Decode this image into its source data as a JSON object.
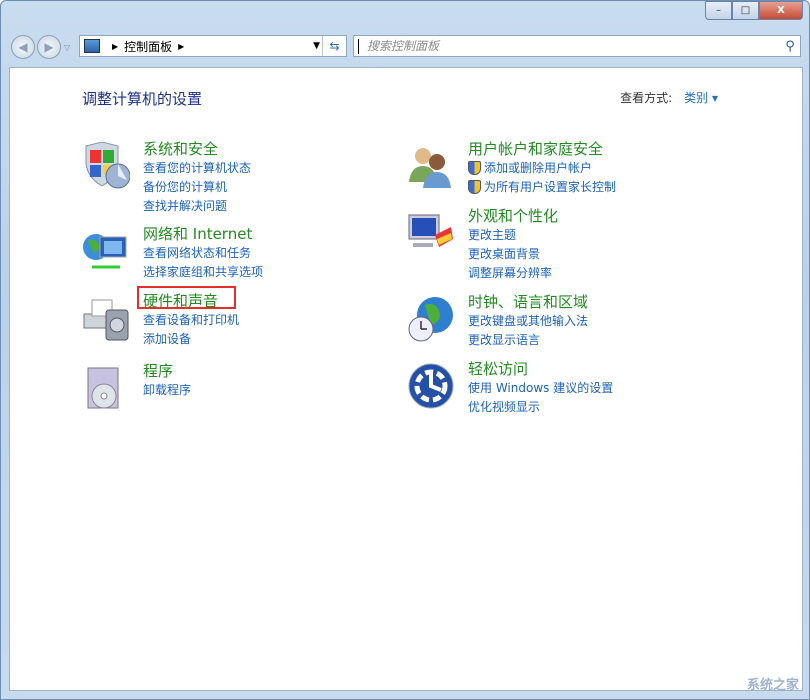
{
  "window": {
    "minimize": "–",
    "maximize": "□",
    "close": "X"
  },
  "address": {
    "crumb": "控制面板"
  },
  "search": {
    "placeholder": "搜索控制面板"
  },
  "heading": "调整计算机的设置",
  "view_by": {
    "label": "查看方式:",
    "value": "类别 ▾"
  },
  "left": [
    {
      "title": "系统和安全",
      "links": [
        "查看您的计算机状态",
        "备份您的计算机",
        "查找并解决问题"
      ]
    },
    {
      "title": "网络和 Internet",
      "links": [
        "查看网络状态和任务",
        "选择家庭组和共享选项"
      ]
    },
    {
      "title": "硬件和声音",
      "links": [
        "查看设备和打印机",
        "添加设备"
      ]
    },
    {
      "title": "程序",
      "links": [
        "卸载程序"
      ]
    }
  ],
  "right": [
    {
      "title": "用户帐户和家庭安全",
      "links": [
        "添加或删除用户帐户",
        "为所有用户设置家长控制"
      ]
    },
    {
      "title": "外观和个性化",
      "links": [
        "更改主题",
        "更改桌面背景",
        "调整屏幕分辨率"
      ]
    },
    {
      "title": "时钟、语言和区域",
      "links": [
        "更改键盘或其他输入法",
        "更改显示语言"
      ]
    },
    {
      "title": "轻松访问",
      "links": [
        "使用 Windows 建议的设置",
        "优化视频显示"
      ]
    }
  ],
  "watermark": "系统之家"
}
